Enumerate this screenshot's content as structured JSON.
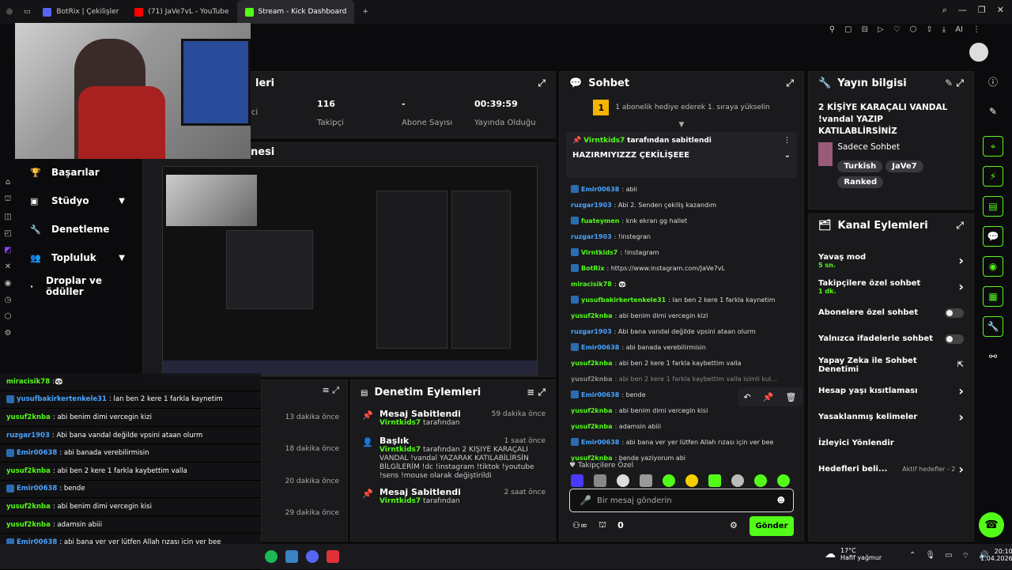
{
  "browser": {
    "tabs": [
      {
        "title": "BotRix | Çekilişler",
        "color": "#5865f2"
      },
      {
        "title": "(71) JaVe7vL - YouTube",
        "color": "#ff0000"
      },
      {
        "title": "Stream - Kick Dashboard",
        "color": "#53fc18"
      }
    ],
    "new_tab": "+",
    "profile": "AI"
  },
  "left_nav": {
    "items": [
      {
        "label": "Başarılar",
        "icon": "trophy-icon",
        "chevron": false
      },
      {
        "label": "Stüdyo",
        "icon": "studio-icon",
        "chevron": true
      },
      {
        "label": "Denetleme",
        "icon": "wrench-icon",
        "chevron": false
      },
      {
        "label": "Topluluk",
        "icon": "people-icon",
        "chevron": true
      },
      {
        "label": "Droplar ve ödüller",
        "icon": "dot-icon",
        "chevron": false
      }
    ]
  },
  "stats": {
    "header": "leri",
    "items": [
      {
        "value": "",
        "label": "yici"
      },
      {
        "value": "116",
        "label": "Takipçi"
      },
      {
        "value": "-",
        "label": "Abone Sayısı"
      },
      {
        "value": "00:39:59",
        "label": "Yayında Olduğu"
      }
    ]
  },
  "preview": {
    "title_partial": "nesi"
  },
  "overlay_chat": [
    {
      "user": "miracisik78",
      "text": ":🐼",
      "color": "green",
      "badge": false
    },
    {
      "user": "yusufbakirkertenkele31",
      "text": ": lan ben 2 kere 1 farkla kaynetim",
      "color": "blue",
      "badge": true
    },
    {
      "user": "yusuf2knba",
      "text": ": abi benim dimi vercegin kizi",
      "color": "green",
      "badge": false
    },
    {
      "user": "ruzgar1903",
      "text": ": Abi bana vandal değilde vpsini ataan olurm",
      "color": "blue",
      "badge": false
    },
    {
      "user": "Emir00638",
      "text": ": abi banada verebilirmisin",
      "color": "blue",
      "badge": true
    },
    {
      "user": "yusuf2knba",
      "text": ": abi ben 2 kere 1 farkla kaybettim valla",
      "color": "green",
      "badge": false
    },
    {
      "user": "Emir00638",
      "text": ": bende",
      "color": "blue",
      "badge": true
    },
    {
      "user": "yusuf2knba",
      "text": ": abi benim dimi vercegin kisi",
      "color": "green",
      "badge": false
    },
    {
      "user": "yusuf2knba",
      "text": ": adamsin abiii",
      "color": "green",
      "badge": false
    },
    {
      "user": "Emir00638",
      "text": ": abi bana ver yer lütfen Allah rızası için ver bee",
      "color": "blue",
      "badge": true
    },
    {
      "user": "yusuf2knba",
      "text": ": bende yaziyorum abi",
      "color": "green",
      "badge": false
    }
  ],
  "chat": {
    "title": "Sohbet",
    "gift_rank": "1",
    "gift_text": "1 abonelik hediye ederek 1. sıraya yükselin",
    "pinned": {
      "user": "Virntkids7",
      "suffix": "tarafından sabitlendi",
      "message": "HAZIRMIYIZZZ ÇEKİLİŞEEE"
    },
    "messages": [
      {
        "user": "Emir00638",
        "text": ": abii",
        "color": "blue",
        "badge": true
      },
      {
        "user": "ruzgar1903",
        "text": ": Abi 2. Senden çekiliş kazandım",
        "color": "blue",
        "badge": false
      },
      {
        "user": "fuateymen",
        "text": ": knk ekran gg hallet",
        "color": "green",
        "badge": true
      },
      {
        "user": "ruzgar1903",
        "text": ": !instegran",
        "color": "blue",
        "badge": false
      },
      {
        "user": "Virntkids7",
        "text": ": !instagram",
        "color": "green",
        "badge": true
      },
      {
        "user": "BotRix",
        "text": ": https://www.instagram.com/JaVe7vL",
        "color": "green",
        "badge": true
      },
      {
        "user": "miracisik78",
        "text": ": 🐼",
        "color": "green",
        "badge": false
      },
      {
        "user": "yusufbakirkertenkele31",
        "text": ": lan ben 2 kere 1 farkla kaynetim",
        "color": "green",
        "badge": true
      },
      {
        "user": "yusuf2knba",
        "text": ": abi benim dimi vercegin kizi",
        "color": "green",
        "badge": false
      },
      {
        "user": "ruzgar1903",
        "text": ": Abi bana vandal değilde vpsini ataan olurm",
        "color": "blue",
        "badge": false
      },
      {
        "user": "Emir00638",
        "text": ": abi banada verebilirmisin",
        "color": "blue",
        "badge": true
      },
      {
        "user": "yusuf2knba",
        "text": ": abi ben 2 kere 1 farkla kaybettim valla",
        "color": "green",
        "badge": false
      },
      {
        "user": "yusuf2knba",
        "text": ": abi ben 2 kere 1 farkla kaybettim valla isimli kul...",
        "color": "grey",
        "badge": false
      },
      {
        "user": "Emir00638",
        "text": ": bende",
        "color": "blue",
        "badge": true
      },
      {
        "user": "yusuf2knba",
        "text": ": abi benim dimi vercegin kisi",
        "color": "green",
        "badge": false
      },
      {
        "user": "yusuf2knba",
        "text": ": adamsin abiii",
        "color": "green",
        "badge": false
      },
      {
        "user": "Emir00638",
        "text": ": abi bana ver yer lütfen Allah rızası için ver bee",
        "color": "blue",
        "badge": true
      },
      {
        "user": "yusuf2knba",
        "text": ": bende yaziyorum abi",
        "color": "green",
        "badge": false
      }
    ],
    "follower_label": "Takipçilere Özel",
    "input_placeholder": "Bir mesaj gönderin",
    "points": "0",
    "send": "Gönder"
  },
  "stream_info": {
    "title": "Yayın bilgisi",
    "stream_title": "2 KİŞİYE KARAÇALI VANDAL !vandal YAZIP KATILABLİRSİNİZ",
    "mode": "Sadece Sohbet",
    "tags": [
      "Turkish",
      "JaVe7",
      "Ranked"
    ]
  },
  "channel_actions": {
    "title": "Kanal Eylemleri",
    "items": [
      {
        "label": "Yavaş mod",
        "sub": "5 sn.",
        "control": "chevron"
      },
      {
        "label": "Takipçilere özel sohbet",
        "sub": "1 dk.",
        "control": "chevron"
      },
      {
        "label": "Abonelere özel sohbet",
        "sub": "",
        "control": "toggle"
      },
      {
        "label": "Yalnızca ifadelerle sohbet",
        "sub": "",
        "control": "toggle"
      },
      {
        "label": "Yapay Zeka ile Sohbet Denetimi",
        "sub": "",
        "control": "external"
      },
      {
        "label": "Hesap yaşı kısıtlaması",
        "sub": "",
        "control": "chevron"
      },
      {
        "label": "Yasaklanmış kelimeler",
        "sub": "",
        "control": "chevron"
      },
      {
        "label": "İzleyici Yönlendir",
        "sub": "",
        "control": "none"
      },
      {
        "label": "Hedefleri beli...",
        "sub": "",
        "control": "chevron",
        "extra": "Aktif hedefler - 2"
      }
    ]
  },
  "moderation": {
    "title": "Denetim Eylemleri",
    "entries": [
      {
        "title": "Mesaj Sabitlendi",
        "time": "59 dakika önce",
        "user": "Virntkids7",
        "desc": "tarafından"
      },
      {
        "title": "Başlık",
        "time": "1 saat önce",
        "user": "Virntkids7",
        "desc": "tarafından 2 KİŞİYE KARAÇALI VANDAL !vandal YAZARAK KATILABİLİRSİN BİLGİLERİM !dc !instagram !tiktok !youtube !sens !mouse olarak değiştirildi"
      },
      {
        "title": "Mesaj Sabitlendi",
        "time": "2 saat önce",
        "user": "Virntkids7",
        "desc": "tarafından"
      }
    ]
  },
  "events": {
    "times": [
      "13 dakika önce",
      "18 dakika önce",
      "20 dakika önce",
      "29 dakika önce"
    ]
  },
  "taskbar": {
    "weather_temp": "17°C",
    "weather_desc": "Hafif yağmur",
    "time": "20:10",
    "date": "1.04.2026"
  }
}
